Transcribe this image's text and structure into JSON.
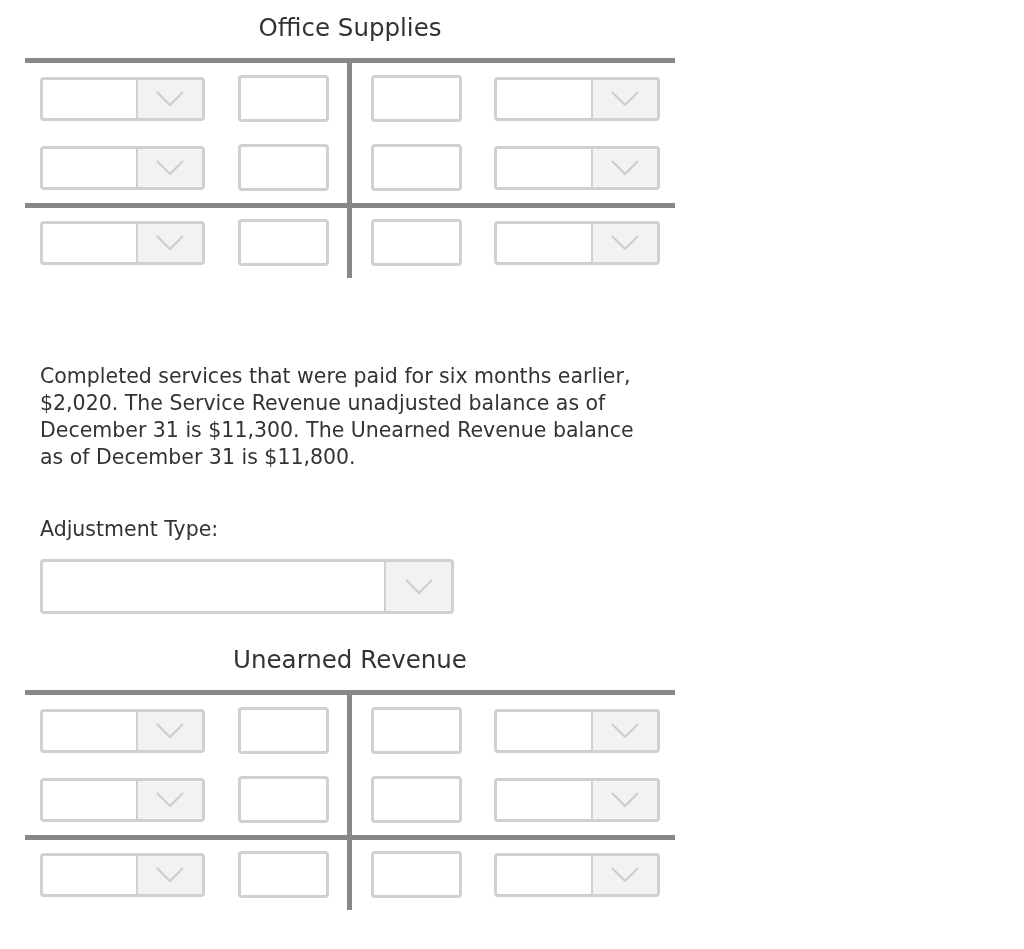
{
  "sections": [
    {
      "kind": "t_account",
      "title": "Office Supplies",
      "rows": [
        {
          "kind": "entry"
        },
        {
          "kind": "entry"
        },
        {
          "kind": "balance"
        }
      ]
    },
    {
      "kind": "transaction",
      "description": "Completed services that were paid for six months earlier, $2,020. The Service Revenue unadjusted balance as of December 31 is $11,300. The Unearned Revenue balance as of December 31 is $11,800.",
      "adjustment": {
        "label": "Adjustment Type:"
      }
    },
    {
      "kind": "t_account",
      "title": "Unearned Revenue",
      "rows": [
        {
          "kind": "entry"
        },
        {
          "kind": "entry"
        },
        {
          "kind": "balance"
        }
      ]
    }
  ]
}
